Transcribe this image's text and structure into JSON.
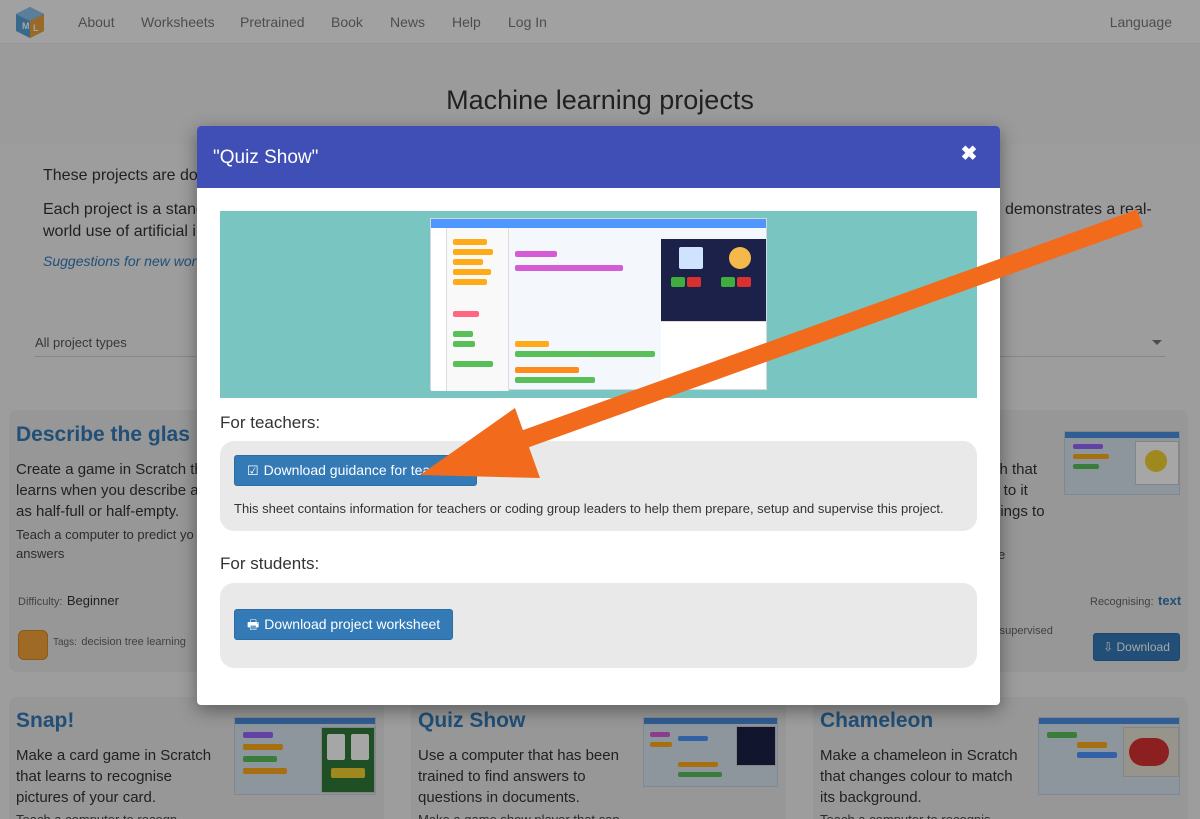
{
  "nav": {
    "items": [
      "About",
      "Worksheets",
      "Pretrained",
      "Book",
      "News",
      "Help",
      "Log In"
    ],
    "language": "Language"
  },
  "hero": {
    "title": "Machine learning projects"
  },
  "intro": {
    "line1": "These projects are do",
    "line2_left": "Each project is a stand",
    "line2_wrap": "world use of artificial in",
    "line2_right": "demonstrates a real-",
    "suggest": "Suggestions for new wor"
  },
  "filter": {
    "project_types": "All project types"
  },
  "cards": {
    "describe": {
      "title": "Describe the glas",
      "desc": [
        "Create a game in Scratch th",
        "learns when you describe a",
        "as half-full or half-empty."
      ],
      "small": [
        "Teach a computer to predict yo",
        "answers"
      ],
      "difficulty_label": "Difficulty:",
      "difficulty": "Beginner",
      "tags_label": "Tags:",
      "tags": "decision tree learning"
    },
    "right": {
      "desc": [
        "ch that",
        "s to it",
        "hings to"
      ],
      "small": "e",
      "recognising_label": "Recognising:",
      "recognising": "text",
      "tags": "s, supervised",
      "download": "Download"
    },
    "snap": {
      "title": "Snap!",
      "desc": [
        "Make a card game in Scratch",
        "that learns to recognise",
        "pictures of your card."
      ],
      "small": "Teach a computer to recogn"
    },
    "quiz": {
      "title": "Quiz Show",
      "desc": [
        "Use a computer that has been",
        "trained to find answers to",
        "questions in documents."
      ],
      "small": "Make a game show player that can"
    },
    "chameleon": {
      "title": "Chameleon",
      "desc": [
        "Make a chameleon in Scratch",
        "that changes colour to match",
        "its background."
      ],
      "small": "Teach a computer to recognis"
    }
  },
  "modal": {
    "title": "\"Quiz Show\"",
    "close_icon": "close-icon",
    "teachers_label": "For teachers:",
    "teachers_button": "Download guidance for teachers",
    "teachers_text": "This sheet contains information for teachers or coding group leaders to help them prepare, setup and supervise this project.",
    "students_label": "For students:",
    "students_button": "Download project worksheet"
  },
  "colors": {
    "modal_header": "#3f4fb5",
    "button": "#337ab7",
    "arrow": "#f26b1d",
    "screenshot_bg": "#79c5c2"
  }
}
